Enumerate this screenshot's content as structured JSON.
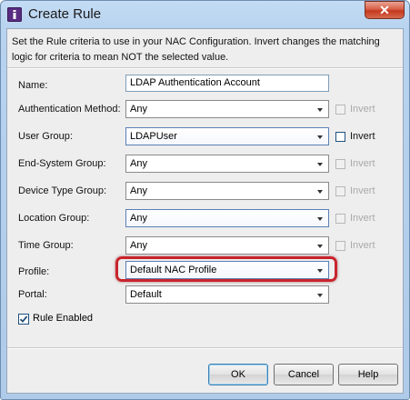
{
  "window": {
    "title": "Create Rule",
    "close_glyph": "✕"
  },
  "description": "Set the Rule criteria to use in your NAC Configuration. Invert changes the matching logic for criteria to mean NOT the selected value.",
  "fields": {
    "name": {
      "label": "Name:",
      "value": "LDAP Authentication Account"
    },
    "auth_method": {
      "label": "Authentication Method:",
      "value": "Any",
      "invert_label": "Invert",
      "invert_enabled": false
    },
    "user_group": {
      "label": "User Group:",
      "value": "LDAPUser",
      "invert_label": "Invert",
      "invert_enabled": true
    },
    "end_system_group": {
      "label": "End-System Group:",
      "value": "Any",
      "invert_label": "Invert",
      "invert_enabled": false
    },
    "device_type_group": {
      "label": "Device Type Group:",
      "value": "Any",
      "invert_label": "Invert",
      "invert_enabled": false
    },
    "location_group": {
      "label": "Location Group:",
      "value": "Any",
      "invert_label": "Invert",
      "invert_enabled": false
    },
    "time_group": {
      "label": "Time Group:",
      "value": "Any",
      "invert_label": "Invert",
      "invert_enabled": false
    },
    "profile": {
      "label": "Profile:",
      "value": "Default NAC Profile"
    },
    "portal": {
      "label": "Portal:",
      "value": "Default"
    }
  },
  "rule_enabled": {
    "label": "Rule Enabled",
    "checked": true
  },
  "buttons": {
    "ok": "OK",
    "cancel": "Cancel",
    "help": "Help"
  },
  "colors": {
    "highlight": "#c8242d",
    "title_bar": "#b8d3ef"
  }
}
